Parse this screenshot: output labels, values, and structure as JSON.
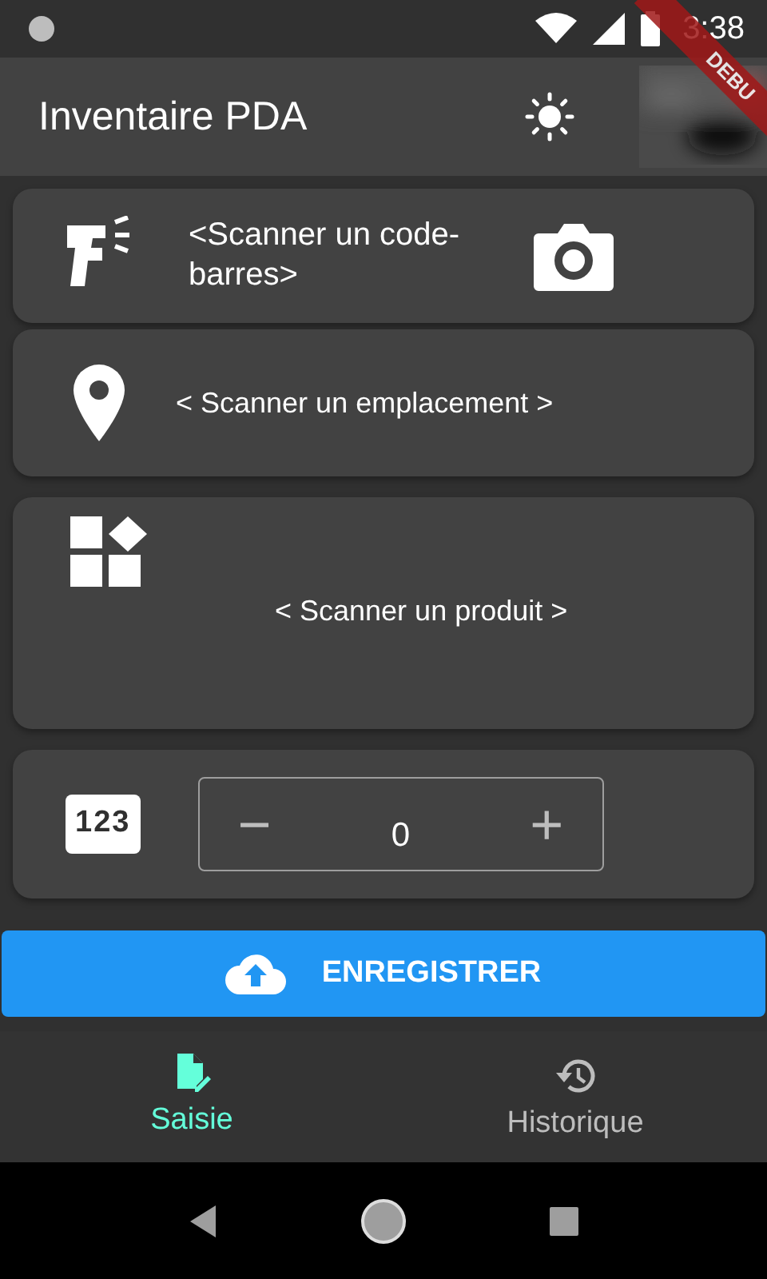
{
  "status_bar": {
    "time": "3:38"
  },
  "debug_banner": {
    "text": "DEBU"
  },
  "app_bar": {
    "title": "Inventaire PDA"
  },
  "cards": [
    {
      "kind": "barcode",
      "text": "<Scanner un code-barres>"
    },
    {
      "kind": "location",
      "text": "< Scanner un emplacement >"
    },
    {
      "kind": "product",
      "text": "< Scanner un produit >"
    },
    {
      "kind": "quantity",
      "badge": "123",
      "minus": "−",
      "value": "0",
      "plus": "+"
    }
  ],
  "save_button": {
    "label": "ENREGISTRER"
  },
  "bottom_nav": [
    {
      "label": "Saisie",
      "kind": "entry",
      "selected": true
    },
    {
      "label": "Historique",
      "kind": "history",
      "selected": false
    }
  ]
}
